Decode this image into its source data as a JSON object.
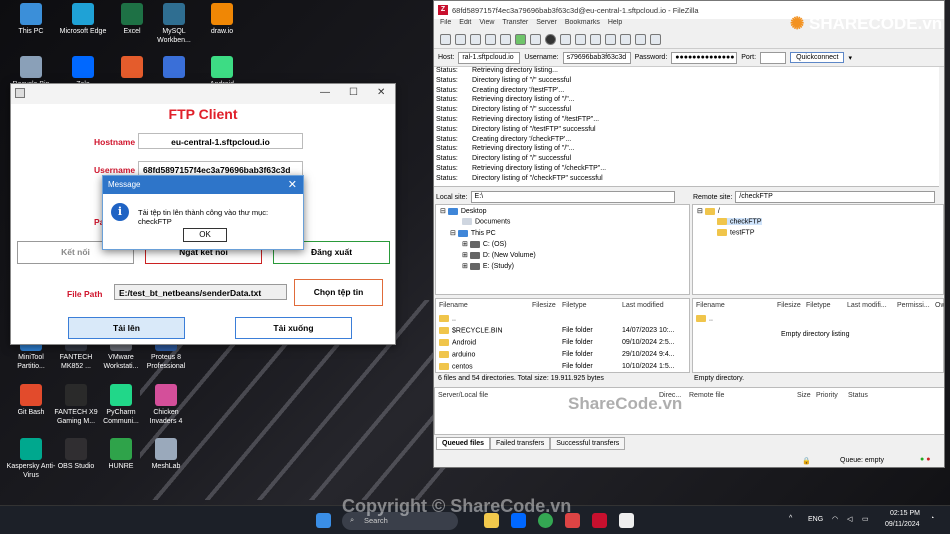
{
  "desktop_icons": [
    {
      "label": "This PC",
      "color": "#3b8fd9"
    },
    {
      "label": "Microsoft Edge",
      "color": "#1fa2d6"
    },
    {
      "label": "Excel",
      "color": "#1e7145"
    },
    {
      "label": "MySQL Workben...",
      "color": "#2f6e91"
    },
    {
      "label": "draw.io",
      "color": "#f08705"
    },
    {
      "label": "Recycle Bin",
      "color": "#8aa0b8"
    },
    {
      "label": "Zalo",
      "color": "#0068ff"
    },
    {
      "label": "",
      "color": "#e45c2c"
    },
    {
      "label": "",
      "color": "#3a6fd8"
    },
    {
      "label": "Android",
      "color": "#3ddc84"
    },
    {
      "label": "MiniTool Partitio...",
      "color": "#2d7fd3"
    },
    {
      "label": "FANTECH MK852 ...",
      "color": "#333844"
    },
    {
      "label": "VMware Workstati...",
      "color": "#6c6f78"
    },
    {
      "label": "Proteus 8 Professional",
      "color": "#2c5aa0"
    },
    {
      "label": "Git Bash",
      "color": "#e24b2c"
    },
    {
      "label": "FANTECH X9 Gaming M...",
      "color": "#2a2a2a"
    },
    {
      "label": "PyCharm Communi...",
      "color": "#21d789"
    },
    {
      "label": "Chicken Invaders 4",
      "color": "#d44f9a"
    },
    {
      "label": "Kaspersky Anti-Virus",
      "color": "#00a88e"
    },
    {
      "label": "OBS Studio",
      "color": "#302e31"
    },
    {
      "label": "HUNRE",
      "color": "#2fa34a"
    },
    {
      "label": "MeshLab",
      "color": "#9aa9bb"
    }
  ],
  "ftp_client": {
    "title": "FTP Client",
    "hostname_label": "Hostname",
    "hostname_value": "eu-central-1.sftpcloud.io",
    "username_label": "Username",
    "username_value": "68fd5897157f4ec3a79696bab3f63c3d",
    "password_label_partial": "Pa",
    "connect_button": "Kết nối",
    "disconnect_button": "Ngắt kết nối",
    "logout_button": "Đăng xuất",
    "filepath_label": "File Path",
    "filepath_value": "E:/test_bt_netbeans/senderData.txt",
    "choose_file_button": "Chọn tệp tin",
    "upload_button": "Tải lên",
    "download_button": "Tải xuống"
  },
  "message_dialog": {
    "title": "Message",
    "text": "Tải tệp tin lên thành công vào thư mục: checkFTP",
    "ok_label": "OK"
  },
  "filezilla": {
    "title": "68fd5897157f4ec3a79696bab3f63c3d@eu-central-1.sftpcloud.io - FileZilla",
    "menu": [
      "File",
      "Edit",
      "View",
      "Transfer",
      "Server",
      "Bookmarks",
      "Help"
    ],
    "host_label": "Host:",
    "host_value": "ral-1.sftpcloud.io",
    "username_label": "Username:",
    "username_value": "s79696bab3f63c3d",
    "password_label": "Password:",
    "password_value": "●●●●●●●●●●●●●●",
    "port_label": "Port:",
    "port_value": "",
    "quickconnect": "Quickconnect",
    "log": [
      [
        "Status:",
        "Retrieving directory listing..."
      ],
      [
        "Status:",
        "Directory listing of \"/\" successful"
      ],
      [
        "Status:",
        "Creating directory '/testFTP'..."
      ],
      [
        "Status:",
        "Retrieving directory listing of \"/\"..."
      ],
      [
        "Status:",
        "Directory listing of \"/\" successful"
      ],
      [
        "Status:",
        "Retrieving directory listing of \"/testFTP\"..."
      ],
      [
        "Status:",
        "Directory listing of \"/testFTP\" successful"
      ],
      [
        "Status:",
        "Creating directory '/checkFTP'..."
      ],
      [
        "Status:",
        "Retrieving directory listing of \"/\"..."
      ],
      [
        "Status:",
        "Directory listing of \"/\" successful"
      ],
      [
        "Status:",
        "Retrieving directory listing of \"/checkFTP\"..."
      ],
      [
        "Status:",
        "Directory listing of \"/checkFTP\" successful"
      ]
    ],
    "local_site_label": "Local site:",
    "local_site_value": "E:\\",
    "remote_site_label": "Remote site:",
    "remote_site_value": "/checkFTP",
    "local_tree": [
      "Desktop",
      "Documents",
      "This PC",
      "C: (OS)",
      "D: (New Volume)",
      "E: (Study)"
    ],
    "remote_tree": [
      "/",
      "checkFTP",
      "testFTP"
    ],
    "local_headers": [
      "Filename",
      "Filesize",
      "Filetype",
      "Last modified"
    ],
    "local_files": [
      [
        "..",
        "",
        "",
        ""
      ],
      [
        "$RECYCLE.BIN",
        "",
        "File folder",
        "14/07/2023 10:..."
      ],
      [
        "Android",
        "",
        "File folder",
        "09/10/2024 2:5..."
      ],
      [
        "arduino",
        "",
        "File folder",
        "29/10/2024 9:4..."
      ],
      [
        "centos",
        "",
        "File folder",
        "10/10/2024 1:5..."
      ]
    ],
    "local_status": "6 files and 54 directories. Total size: 19.911.925 bytes",
    "remote_headers": [
      "Filename",
      "Filesize",
      "Filetype",
      "Last modifi...",
      "Permissi...",
      "Ow"
    ],
    "remote_files": [
      [
        ".."
      ]
    ],
    "remote_empty": "Empty directory listing",
    "remote_status": "Empty directory.",
    "queue_headers": [
      "Server/Local file",
      "Direc...",
      "Remote file",
      "Size",
      "Priority",
      "Status"
    ],
    "queue_tabs": [
      "Queued files",
      "Failed transfers",
      "Successful transfers"
    ],
    "queue_status": "Queue: empty"
  },
  "taskbar": {
    "search_placeholder": "Search",
    "language": "ENG",
    "time": "02:15 PM",
    "date": "09/11/2024"
  },
  "watermarks": {
    "logo": "SHARECODE.vn",
    "center": "ShareCode.vn",
    "bottom": "Copyright © ShareCode.vn"
  }
}
